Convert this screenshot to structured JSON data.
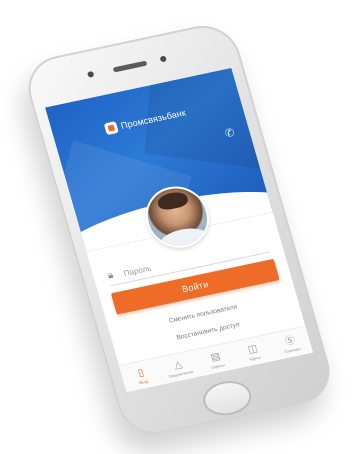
{
  "app": {
    "brand_name": "Промсвязьбанк",
    "brand_color": "#ee6b28",
    "header_color": "#1f63c5"
  },
  "header": {
    "call_icon": "phone-icon"
  },
  "profile": {
    "avatar_icon": "user-photo"
  },
  "login": {
    "password_placeholder": "Пароль",
    "password_icon": "lock-icon",
    "submit_label": "Войти",
    "change_user_label": "Сменить пользователя",
    "restore_access_label": "Восстановить доступ"
  },
  "tabbar": {
    "items": [
      {
        "label": "Вход",
        "icon": "phone-login-icon",
        "active": true
      },
      {
        "label": "Уведомления",
        "icon": "bell-icon",
        "active": false
      },
      {
        "label": "Офисы",
        "icon": "bank-icon",
        "active": false
      },
      {
        "label": "Курсы",
        "icon": "chart-icon",
        "active": false
      },
      {
        "label": "Платежи",
        "icon": "coin-icon",
        "active": false
      }
    ]
  }
}
